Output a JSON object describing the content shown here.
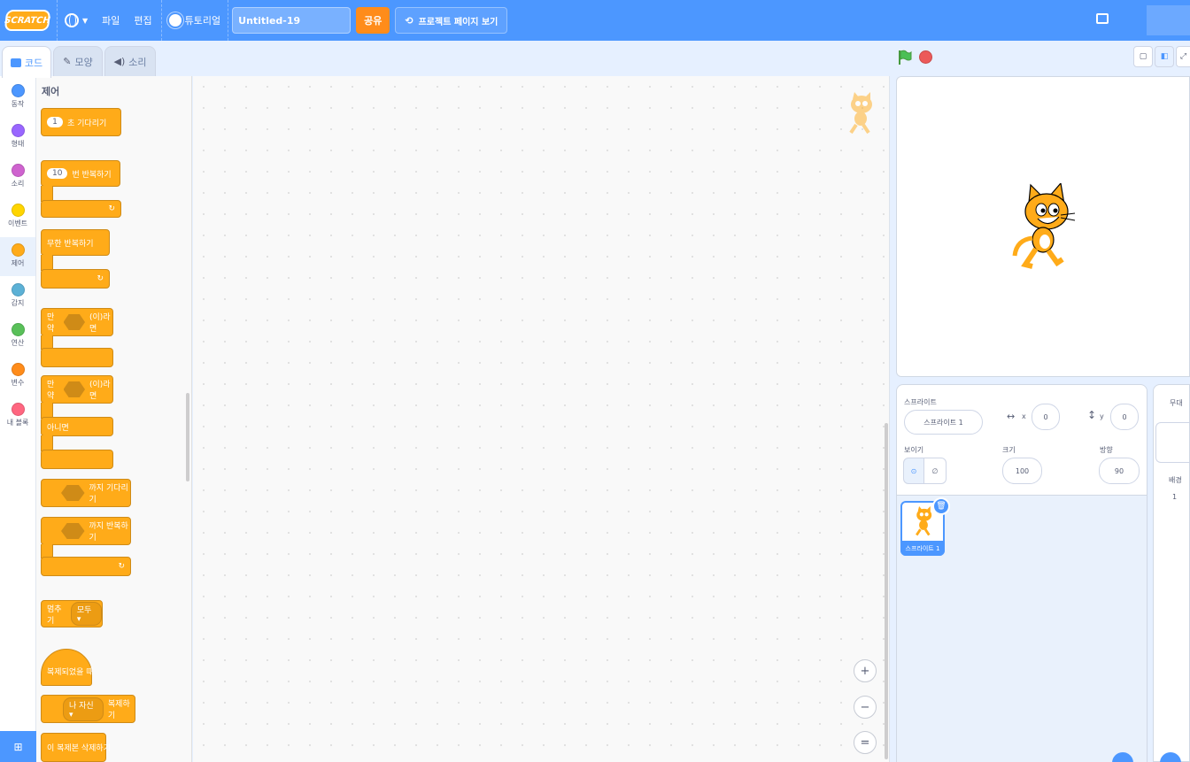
{
  "menubar": {
    "logo": "SCRATCH",
    "file": "파일",
    "edit": "편집",
    "tutorials": "튜토리얼",
    "project_title": "Untitled-19",
    "share": "공유",
    "see_project_page": "프로젝트 페이지 보기"
  },
  "tabs": {
    "code": "코드",
    "costumes": "모양",
    "sounds": "소리"
  },
  "categories": [
    {
      "label": "동작",
      "color": "#4c97ff"
    },
    {
      "label": "형태",
      "color": "#9966ff"
    },
    {
      "label": "소리",
      "color": "#cf63cf"
    },
    {
      "label": "이벤트",
      "color": "#ffd500"
    },
    {
      "label": "제어",
      "color": "#ffab19"
    },
    {
      "label": "감지",
      "color": "#5cb1d6"
    },
    {
      "label": "연산",
      "color": "#59c059"
    },
    {
      "label": "변수",
      "color": "#ff8c1a"
    },
    {
      "label": "내 블록",
      "color": "#ff6680"
    }
  ],
  "palette": {
    "title": "제어",
    "wait": {
      "value": "1",
      "text": "초 기다리기"
    },
    "repeat": {
      "value": "10",
      "text": "번 반복하기"
    },
    "forever": "무한 반복하기",
    "if_then": {
      "prefix": "만약",
      "suffix": "(이)라면"
    },
    "if_else": {
      "prefix": "만약",
      "suffix": "(이)라면",
      "else": "아니면"
    },
    "wait_until": "까지 기다리기",
    "repeat_until": "까지 반복하기",
    "stop": {
      "text": "멈추기",
      "option": "모두 ▾"
    },
    "when_clone": "복제되었을 때",
    "create_clone": {
      "option": "나 자신 ▾",
      "text": "복제하기"
    },
    "delete_clone": "이 복제본 삭제하기"
  },
  "zoom": {
    "in": "+",
    "out": "−",
    "reset": "="
  },
  "sprite_info": {
    "sprite_label": "스프라이트",
    "sprite_name": "스프라이트 1",
    "x_label": "x",
    "x_value": "0",
    "y_label": "y",
    "y_value": "0",
    "show_label": "보이기",
    "size_label": "크기",
    "size_value": "100",
    "direction_label": "방향",
    "direction_value": "90"
  },
  "sprite_list": [
    {
      "name": "스프라이트 1"
    }
  ],
  "stage_pane": {
    "title": "무대",
    "backdrops_label": "배경",
    "backdrops_count": "1"
  }
}
